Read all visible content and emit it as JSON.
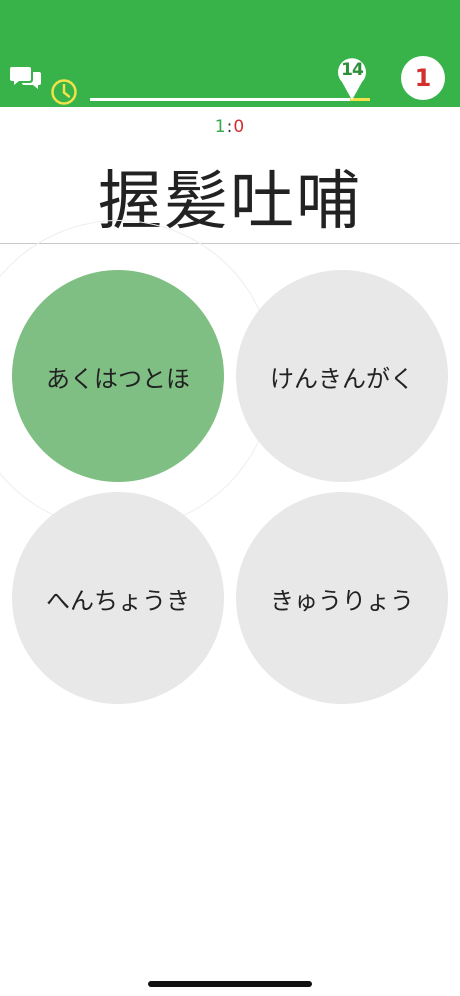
{
  "header": {
    "timer_value": "14",
    "timer_progress": 0.93,
    "player_rank": "1",
    "colors": {
      "bar": "#37b34a",
      "accent": "#f1e24a",
      "rank": "#d32f2f"
    },
    "icons": [
      "chat-icon",
      "clock-icon",
      "map-pin-icon"
    ]
  },
  "match": {
    "left": "1",
    "separator": ":",
    "right": "0"
  },
  "question": {
    "text": "握髪吐哺"
  },
  "options": [
    {
      "label": "あくはつとほ",
      "selected": true
    },
    {
      "label": "けんきんがく",
      "selected": false
    },
    {
      "label": "へんちょうき",
      "selected": false
    },
    {
      "label": "きゅうりょう",
      "selected": false
    }
  ]
}
